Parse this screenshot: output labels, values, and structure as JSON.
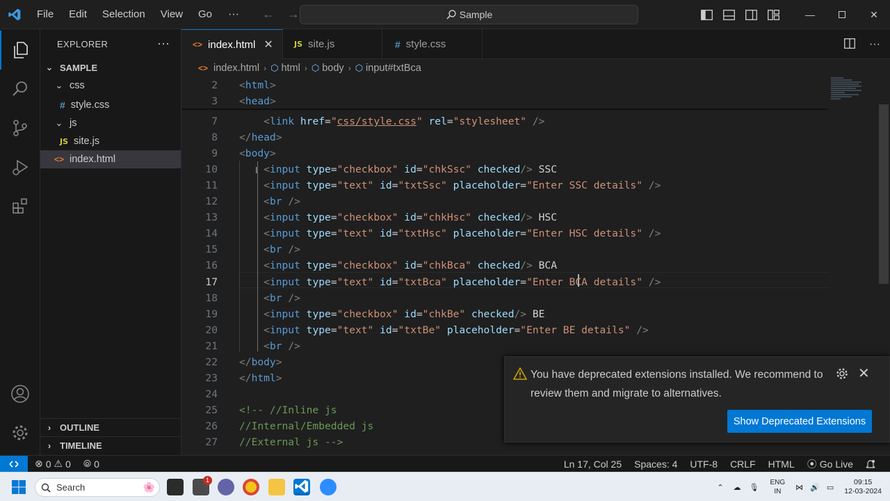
{
  "titlebar": {
    "menus": [
      "File",
      "Edit",
      "Selection",
      "View",
      "Go"
    ],
    "more": "···",
    "search_text": "Sample"
  },
  "sidebar": {
    "title": "EXPLORER",
    "more": "···",
    "root": "SAMPLE",
    "tree": [
      {
        "label": "css",
        "type": "folder"
      },
      {
        "label": "style.css",
        "type": "css"
      },
      {
        "label": "js",
        "type": "folder"
      },
      {
        "label": "site.js",
        "type": "js"
      },
      {
        "label": "index.html",
        "type": "html",
        "selected": true
      }
    ],
    "outline": "OUTLINE",
    "timeline": "TIMELINE"
  },
  "tabs": [
    {
      "label": "index.html",
      "active": true
    },
    {
      "label": "site.js",
      "active": false
    },
    {
      "label": "style.css",
      "active": false
    }
  ],
  "breadcrumb": [
    "index.html",
    "html",
    "body",
    "input#txtBca"
  ],
  "editor": {
    "current_line": 17,
    "lines": [
      {
        "n": "2",
        "tokens": [
          [
            "p",
            "<"
          ],
          [
            "t",
            "html"
          ],
          [
            "p",
            ">"
          ]
        ]
      },
      {
        "n": "3",
        "tokens": [
          [
            "p",
            "<"
          ],
          [
            "t",
            "head"
          ],
          [
            "p",
            ">"
          ]
        ]
      },
      {
        "n": "7",
        "tokens": [
          [
            "x",
            "    "
          ],
          [
            "p",
            "<"
          ],
          [
            "t",
            "link "
          ],
          [
            "a",
            "href"
          ],
          [
            "x",
            "="
          ],
          [
            "s",
            "\""
          ],
          [
            "su",
            "css/style.css"
          ],
          [
            "s",
            "\""
          ],
          [
            "x",
            " "
          ],
          [
            "a",
            "rel"
          ],
          [
            "x",
            "="
          ],
          [
            "s",
            "\"stylesheet\""
          ],
          [
            "x",
            " "
          ],
          [
            "p",
            "/>"
          ]
        ]
      },
      {
        "n": "8",
        "tokens": [
          [
            "p",
            "</"
          ],
          [
            "t",
            "head"
          ],
          [
            "p",
            ">"
          ]
        ]
      },
      {
        "n": "9",
        "tokens": [
          [
            "p",
            "<"
          ],
          [
            "t",
            "body"
          ],
          [
            "p",
            ">"
          ]
        ]
      },
      {
        "n": "10",
        "tokens": [
          [
            "x",
            "    "
          ],
          [
            "p",
            "<"
          ],
          [
            "t",
            "input "
          ],
          [
            "a",
            "type"
          ],
          [
            "x",
            "="
          ],
          [
            "s",
            "\"checkbox\""
          ],
          [
            "x",
            " "
          ],
          [
            "a",
            "id"
          ],
          [
            "x",
            "="
          ],
          [
            "s",
            "\"chkSsc\""
          ],
          [
            "x",
            " "
          ],
          [
            "a",
            "checked"
          ],
          [
            "p",
            "/>"
          ],
          [
            "x",
            " SSC"
          ]
        ]
      },
      {
        "n": "11",
        "tokens": [
          [
            "x",
            "    "
          ],
          [
            "p",
            "<"
          ],
          [
            "t",
            "input "
          ],
          [
            "a",
            "type"
          ],
          [
            "x",
            "="
          ],
          [
            "s",
            "\"text\""
          ],
          [
            "x",
            " "
          ],
          [
            "a",
            "id"
          ],
          [
            "x",
            "="
          ],
          [
            "s",
            "\"txtSsc\""
          ],
          [
            "x",
            " "
          ],
          [
            "a",
            "placeholder"
          ],
          [
            "x",
            "="
          ],
          [
            "s",
            "\"Enter SSC details\""
          ],
          [
            "x",
            " "
          ],
          [
            "p",
            "/>"
          ]
        ]
      },
      {
        "n": "12",
        "tokens": [
          [
            "x",
            "    "
          ],
          [
            "p",
            "<"
          ],
          [
            "t",
            "br "
          ],
          [
            "p",
            "/>"
          ]
        ]
      },
      {
        "n": "13",
        "tokens": [
          [
            "x",
            "    "
          ],
          [
            "p",
            "<"
          ],
          [
            "t",
            "input "
          ],
          [
            "a",
            "type"
          ],
          [
            "x",
            "="
          ],
          [
            "s",
            "\"checkbox\""
          ],
          [
            "x",
            " "
          ],
          [
            "a",
            "id"
          ],
          [
            "x",
            "="
          ],
          [
            "s",
            "\"chkHsc\""
          ],
          [
            "x",
            " "
          ],
          [
            "a",
            "checked"
          ],
          [
            "p",
            "/>"
          ],
          [
            "x",
            " HSC"
          ]
        ]
      },
      {
        "n": "14",
        "tokens": [
          [
            "x",
            "    "
          ],
          [
            "p",
            "<"
          ],
          [
            "t",
            "input "
          ],
          [
            "a",
            "type"
          ],
          [
            "x",
            "="
          ],
          [
            "s",
            "\"text\""
          ],
          [
            "x",
            " "
          ],
          [
            "a",
            "id"
          ],
          [
            "x",
            "="
          ],
          [
            "s",
            "\"txtHsc\""
          ],
          [
            "x",
            " "
          ],
          [
            "a",
            "placeholder"
          ],
          [
            "x",
            "="
          ],
          [
            "s",
            "\"Enter HSC details\""
          ],
          [
            "x",
            " "
          ],
          [
            "p",
            "/>"
          ]
        ]
      },
      {
        "n": "15",
        "tokens": [
          [
            "x",
            "    "
          ],
          [
            "p",
            "<"
          ],
          [
            "t",
            "br "
          ],
          [
            "p",
            "/>"
          ]
        ]
      },
      {
        "n": "16",
        "tokens": [
          [
            "x",
            "    "
          ],
          [
            "p",
            "<"
          ],
          [
            "t",
            "input "
          ],
          [
            "a",
            "type"
          ],
          [
            "x",
            "="
          ],
          [
            "s",
            "\"checkbox\""
          ],
          [
            "x",
            " "
          ],
          [
            "a",
            "id"
          ],
          [
            "x",
            "="
          ],
          [
            "s",
            "\"chkBca\""
          ],
          [
            "x",
            " "
          ],
          [
            "a",
            "checked"
          ],
          [
            "p",
            "/>"
          ],
          [
            "x",
            " BCA"
          ]
        ]
      },
      {
        "n": "17",
        "tokens": [
          [
            "x",
            "    "
          ],
          [
            "p",
            "<"
          ],
          [
            "t",
            "input "
          ],
          [
            "a",
            "type"
          ],
          [
            "x",
            "="
          ],
          [
            "s",
            "\"text\""
          ],
          [
            "x",
            " "
          ],
          [
            "a",
            "id"
          ],
          [
            "x",
            "="
          ],
          [
            "s",
            "\"txtBca\""
          ],
          [
            "x",
            " "
          ],
          [
            "a",
            "placeholder"
          ],
          [
            "x",
            "="
          ],
          [
            "s",
            "\"Enter BCA details\""
          ],
          [
            "x",
            " "
          ],
          [
            "p",
            "/>"
          ]
        ]
      },
      {
        "n": "18",
        "tokens": [
          [
            "x",
            "    "
          ],
          [
            "p",
            "<"
          ],
          [
            "t",
            "br "
          ],
          [
            "p",
            "/>"
          ]
        ]
      },
      {
        "n": "19",
        "tokens": [
          [
            "x",
            "    "
          ],
          [
            "p",
            "<"
          ],
          [
            "t",
            "input "
          ],
          [
            "a",
            "type"
          ],
          [
            "x",
            "="
          ],
          [
            "s",
            "\"checkbox\""
          ],
          [
            "x",
            " "
          ],
          [
            "a",
            "id"
          ],
          [
            "x",
            "="
          ],
          [
            "s",
            "\"chkBe\""
          ],
          [
            "x",
            " "
          ],
          [
            "a",
            "checked"
          ],
          [
            "p",
            "/>"
          ],
          [
            "x",
            " BE"
          ]
        ]
      },
      {
        "n": "20",
        "tokens": [
          [
            "x",
            "    "
          ],
          [
            "p",
            "<"
          ],
          [
            "t",
            "input "
          ],
          [
            "a",
            "type"
          ],
          [
            "x",
            "="
          ],
          [
            "s",
            "\"text\""
          ],
          [
            "x",
            " "
          ],
          [
            "a",
            "id"
          ],
          [
            "x",
            "="
          ],
          [
            "s",
            "\"txtBe\""
          ],
          [
            "x",
            " "
          ],
          [
            "a",
            "placeholder"
          ],
          [
            "x",
            "="
          ],
          [
            "s",
            "\"Enter BE details\""
          ],
          [
            "x",
            " "
          ],
          [
            "p",
            "/>"
          ]
        ]
      },
      {
        "n": "21",
        "tokens": [
          [
            "x",
            "    "
          ],
          [
            "p",
            "<"
          ],
          [
            "t",
            "br "
          ],
          [
            "p",
            "/>"
          ]
        ]
      },
      {
        "n": "22",
        "tokens": [
          [
            "p",
            "</"
          ],
          [
            "t",
            "body"
          ],
          [
            "p",
            ">"
          ]
        ]
      },
      {
        "n": "23",
        "tokens": [
          [
            "p",
            "</"
          ],
          [
            "t",
            "html"
          ],
          [
            "p",
            ">"
          ]
        ]
      },
      {
        "n": "24",
        "tokens": []
      },
      {
        "n": "25",
        "tokens": [
          [
            "c",
            "<!-- //Inline js"
          ]
        ]
      },
      {
        "n": "26",
        "tokens": [
          [
            "c",
            "//Internal/Embedded js"
          ]
        ]
      },
      {
        "n": "27",
        "tokens": [
          [
            "c",
            "//External js -->"
          ]
        ]
      }
    ]
  },
  "notification": {
    "message": "You have deprecated extensions installed. We recommend to review them and migrate to alternatives.",
    "button": "Show Deprecated Extensions"
  },
  "statusbar": {
    "errors": "0",
    "warnings": "0",
    "ports": "0",
    "position": "Ln 17, Col 25",
    "spaces": "Spaces: 4",
    "encoding": "UTF-8",
    "eol": "CRLF",
    "language": "HTML",
    "golive": "Go Live"
  },
  "taskbar": {
    "search": "Search",
    "lang_top": "ENG",
    "lang_bottom": "IN",
    "time": "09:15",
    "date": "12-03-2024",
    "badge": "1"
  },
  "colors": {
    "accent": "#0078d4",
    "tag": "#569cd6",
    "attr": "#9cdcfe",
    "string": "#ce9178",
    "comment": "#6a9955"
  }
}
